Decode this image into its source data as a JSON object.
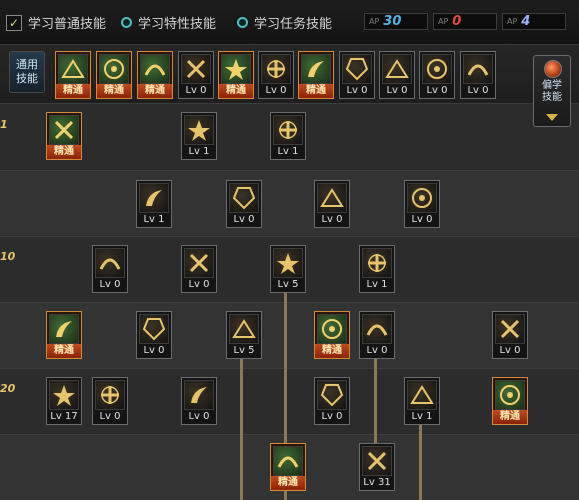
{
  "tabs": [
    {
      "label": "学习普通技能",
      "state": "checked"
    },
    {
      "label": "学习特性技能",
      "state": "radio"
    },
    {
      "label": "学习任务技能",
      "state": "radio"
    }
  ],
  "points": [
    {
      "label": "AP",
      "value": "30",
      "color": "#4fb5e8"
    },
    {
      "label": "AP",
      "value": "0",
      "color": "#e24a3a"
    },
    {
      "label": "AP",
      "value": "4",
      "color": "#9fb4ff"
    }
  ],
  "common_label": "通用技能",
  "side_button_label": "偏学技能",
  "level_markers": [
    "1",
    "10",
    "20"
  ],
  "common_skills": [
    {
      "icon": "crouch-icon",
      "caption": "精通",
      "master": true
    },
    {
      "icon": "kick-icon",
      "caption": "精通",
      "master": true
    },
    {
      "icon": "dash-icon",
      "caption": "精通",
      "master": true
    },
    {
      "icon": "wings-icon",
      "caption": "Lv 0",
      "master": false
    },
    {
      "icon": "target-icon",
      "caption": "精通",
      "master": true
    },
    {
      "icon": "target-plus-icon",
      "caption": "Lv 0",
      "master": false
    },
    {
      "icon": "stance-icon",
      "caption": "精通",
      "master": true
    },
    {
      "icon": "dragon-icon",
      "caption": "Lv 0",
      "master": false
    },
    {
      "icon": "eye-ring-icon",
      "caption": "Lv 0",
      "master": false
    },
    {
      "icon": "armor-icon",
      "caption": "Lv 0",
      "master": false
    },
    {
      "icon": "tower-icon",
      "caption": "Lv 0",
      "master": false
    }
  ],
  "tree_skills": [
    {
      "icon": "dragon-icon",
      "caption": "精通",
      "master": true
    },
    {
      "icon": "kunai-icon",
      "caption": "Lv 1",
      "master": false
    },
    {
      "icon": "sword-swing-icon",
      "caption": "Lv 1",
      "master": false
    },
    {
      "icon": "flame-slash-icon",
      "caption": "Lv 1",
      "master": false
    },
    {
      "icon": "runner-icon",
      "caption": "Lv 0",
      "master": false
    },
    {
      "icon": "fireball-icon",
      "caption": "Lv 0",
      "master": false
    },
    {
      "icon": "crescent-icon",
      "caption": "Lv 0",
      "master": false
    },
    {
      "icon": "shield-icon",
      "caption": "Lv 0",
      "master": false
    },
    {
      "icon": "sprint-icon",
      "caption": "Lv 0",
      "master": false
    },
    {
      "icon": "wave-slash-icon",
      "caption": "Lv 5",
      "master": false
    },
    {
      "icon": "claw-icon",
      "caption": "Lv 1",
      "master": false
    },
    {
      "icon": "leap-icon",
      "caption": "精通",
      "master": true
    },
    {
      "icon": "spin-icon",
      "caption": "Lv 0",
      "master": false
    },
    {
      "icon": "burst-icon",
      "caption": "Lv 5",
      "master": false
    },
    {
      "icon": "sun-burst-icon",
      "caption": "精通",
      "master": true
    },
    {
      "icon": "ring-target-icon",
      "caption": "Lv 0",
      "master": false
    },
    {
      "icon": "fire-claw-icon",
      "caption": "Lv 0",
      "master": false
    },
    {
      "icon": "crossed-blades-icon",
      "caption": "Lv 17",
      "master": false
    },
    {
      "icon": "crossed-swords-icon",
      "caption": "Lv 0",
      "master": false
    },
    {
      "icon": "wind-icon",
      "caption": "Lv 0",
      "master": false
    },
    {
      "icon": "kunai-strike-icon",
      "caption": "Lv 0",
      "master": false
    },
    {
      "icon": "vortex-icon",
      "caption": "Lv 1",
      "master": false
    },
    {
      "icon": "flame-blade-icon",
      "caption": "精通",
      "master": true
    },
    {
      "icon": "slash-wave-icon",
      "caption": "精通",
      "master": true
    },
    {
      "icon": "red-slash-icon",
      "caption": "Lv 31",
      "master": false
    }
  ]
}
